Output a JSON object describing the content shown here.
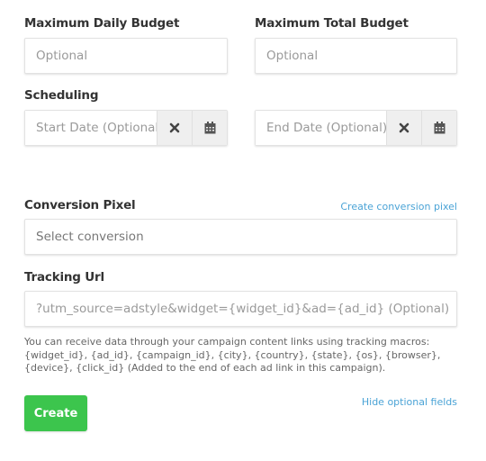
{
  "daily_budget": {
    "label": "Maximum Daily Budget",
    "placeholder": "Optional"
  },
  "total_budget": {
    "label": "Maximum Total Budget",
    "placeholder": "Optional"
  },
  "scheduling": {
    "label": "Scheduling",
    "start_placeholder": "Start Date (Optional)",
    "end_placeholder": "End Date (Optional)"
  },
  "conversion_pixel": {
    "label": "Conversion Pixel",
    "create_link": "Create conversion pixel",
    "placeholder": "Select conversion"
  },
  "tracking_url": {
    "label": "Tracking Url",
    "placeholder": "?utm_source=adstyle&widget={widget_id}&ad={ad_id} (Optional)",
    "help": "You can receive data through your campaign content links using tracking macros: {widget_id}, {ad_id}, {campaign_id}, {city}, {country}, {state}, {os}, {browser}, {device}, {click_id} (Added to the end of each ad link in this campaign)."
  },
  "actions": {
    "create_label": "Create",
    "hide_optional": "Hide optional fields"
  },
  "icons": {
    "clear": "times-icon",
    "calendar": "calendar-icon"
  },
  "colors": {
    "primary": "#3cc54d",
    "link": "#4aa3d6"
  }
}
